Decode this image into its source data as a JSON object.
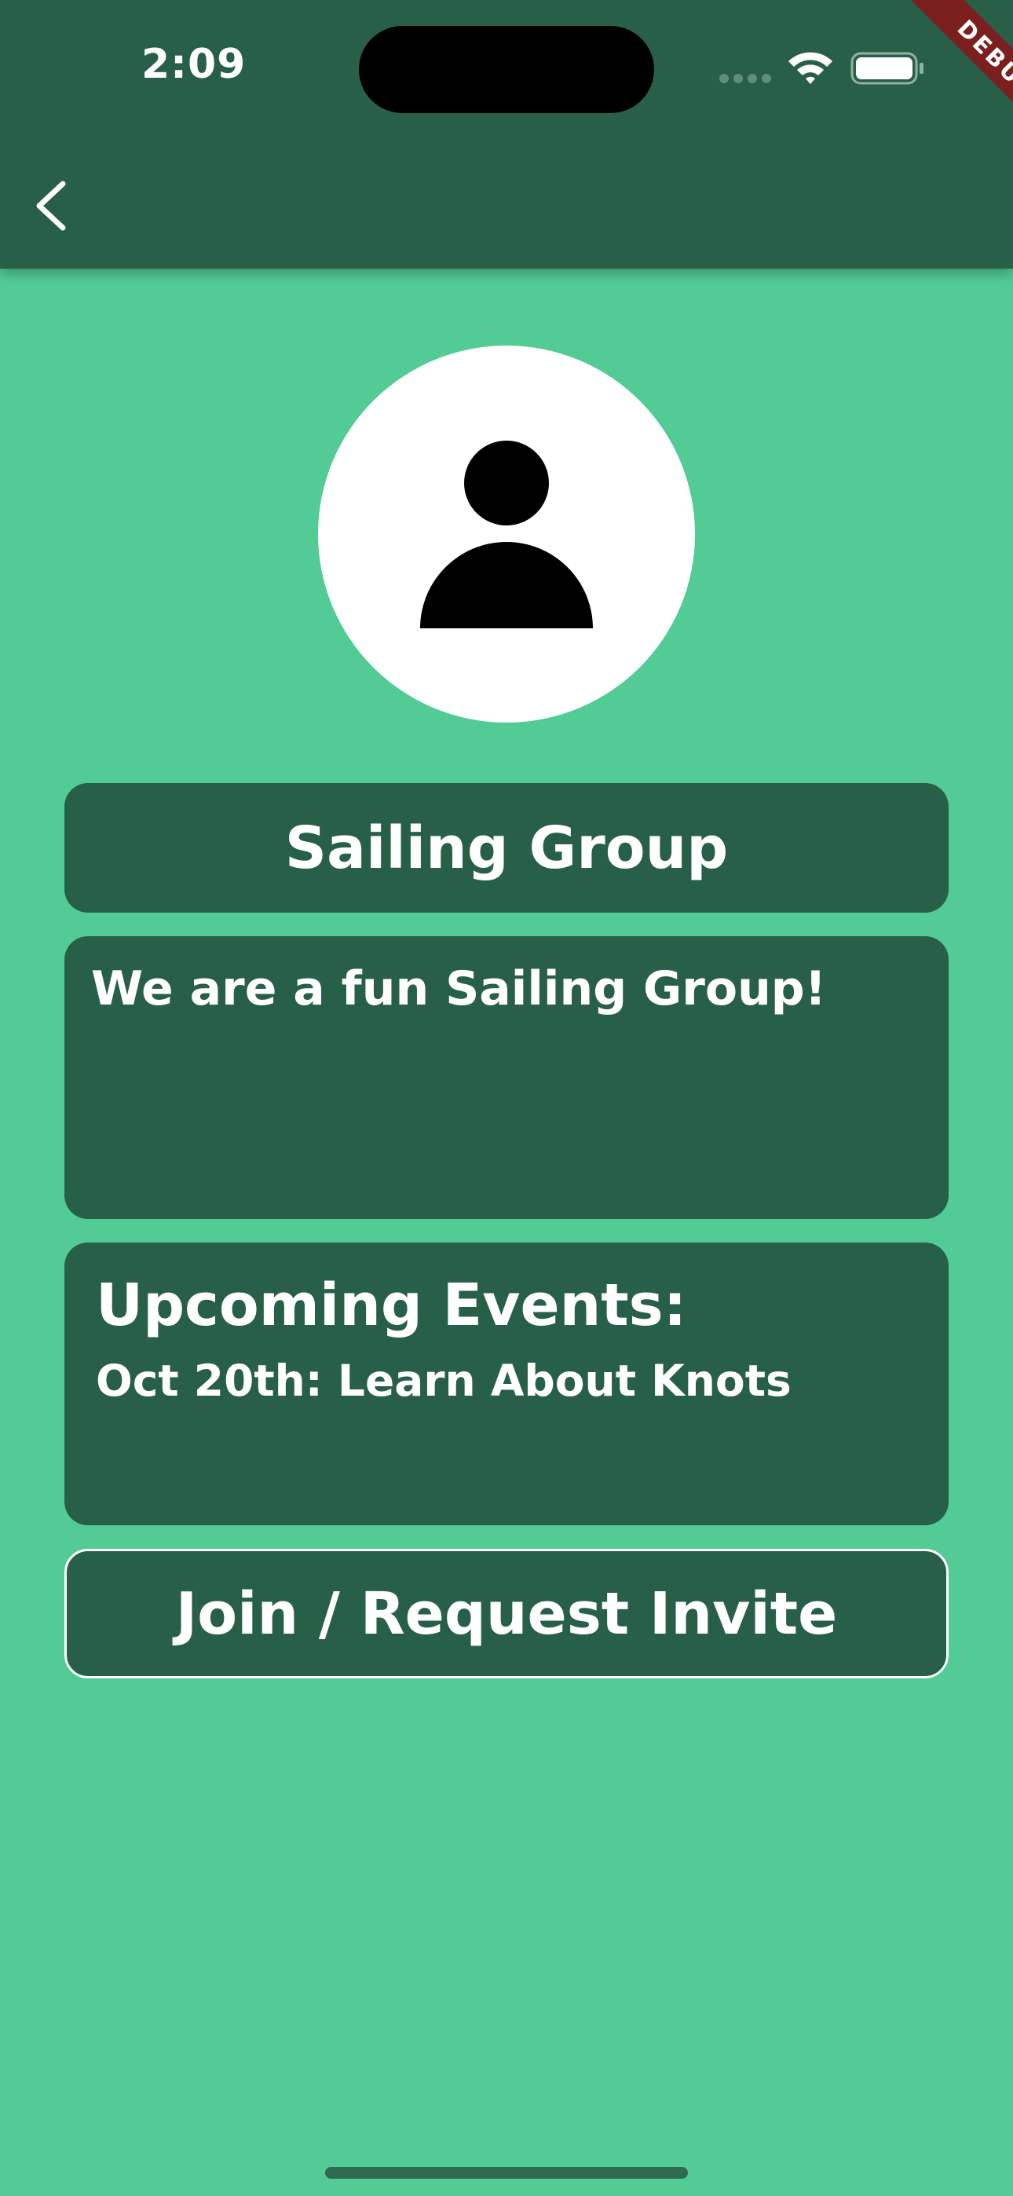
{
  "status_bar": {
    "time": "2:09"
  },
  "debug_banner": {
    "label": "DEBUG",
    "color": "#7b1f1f"
  },
  "app_bar": {
    "back_icon": "chevron-left-icon"
  },
  "group": {
    "avatar_icon": "person-icon",
    "name": "Sailing Group",
    "description": "We are a fun Sailing Group!"
  },
  "events": {
    "heading": "Upcoming Events:",
    "items": [
      "Oct 20th: Learn About Knots"
    ]
  },
  "actions": {
    "join_label": "Join / Request Invite"
  },
  "colors": {
    "background": "#52cb94",
    "primary_dark": "#285f48",
    "text": "#ffffff"
  }
}
